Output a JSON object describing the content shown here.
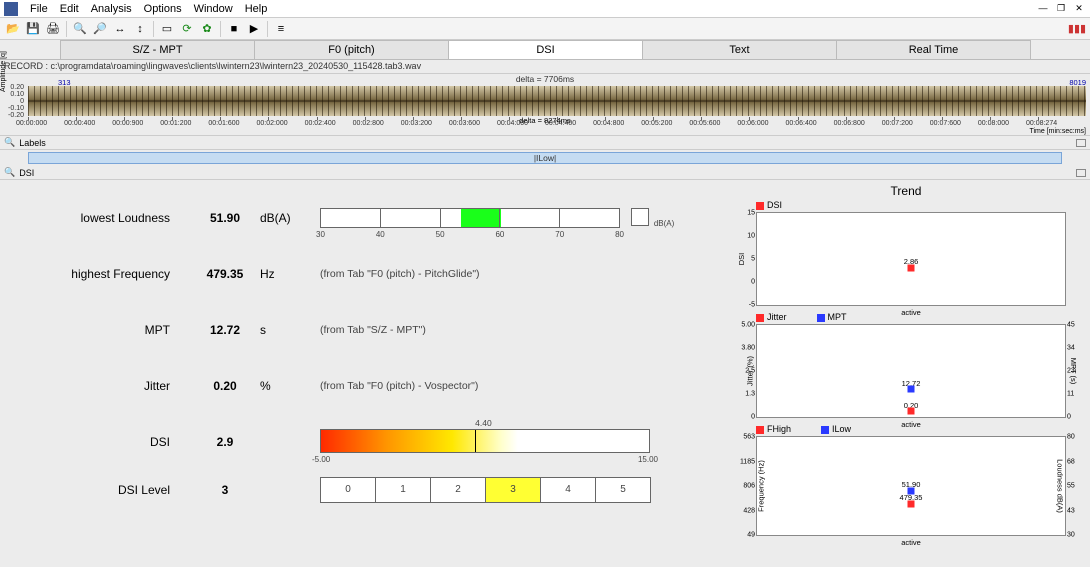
{
  "menu": {
    "items": [
      "File",
      "Edit",
      "Analysis",
      "Options",
      "Window",
      "Help"
    ]
  },
  "tabs": {
    "items": [
      "S/Z - MPT",
      "F0 (pitch)",
      "DSI",
      "Text",
      "Real Time"
    ],
    "active": 2
  },
  "record_path": "RECORD : c:\\programdata\\roaming\\lingwaves\\clients\\lwintern23\\lwintern23_20240530_115428.tab3.wav",
  "delta_top": "delta = 7706ms",
  "delta_mid": "delta = 8274ms",
  "waveform": {
    "marker_left": "313",
    "marker_right": "8019",
    "y_ticks": [
      "0.20",
      "0.10",
      "0",
      "-0.10",
      "-0.20"
    ],
    "y_label": "Amplitude [q]",
    "time_ticks": [
      "00:00:000",
      "00:00:400",
      "00:00:900",
      "00:01:200",
      "00:01:600",
      "00:02:000",
      "00:02:400",
      "00:02:800",
      "00:03:200",
      "00:03:600",
      "00:04:000",
      "00:04:400",
      "00:04:800",
      "00:05:200",
      "00:05:600",
      "00:06:000",
      "00:06:400",
      "00:06:800",
      "00:07:200",
      "00:07:600",
      "00:08:000",
      "00:08:274"
    ],
    "time_unit": "Time [min:sec:ms]"
  },
  "sections": {
    "labels": "Labels",
    "dsi": "DSI"
  },
  "label_segment": "|ILow|",
  "params": {
    "lowest_loudness": {
      "label": "lowest Loudness",
      "value": "51.90",
      "unit": "dB(A)"
    },
    "highest_freq": {
      "label": "highest Frequency",
      "value": "479.35",
      "unit": "Hz",
      "note": "(from Tab \"F0 (pitch) - PitchGlide\")"
    },
    "mpt": {
      "label": "MPT",
      "value": "12.72",
      "unit": "s",
      "note": "(from Tab \"S/Z - MPT\")"
    },
    "jitter": {
      "label": "Jitter",
      "value": "0.20",
      "unit": "%",
      "note": "(from Tab \"F0 (pitch) - Vospector\")"
    },
    "dsi": {
      "label": "DSI",
      "value": "2.9"
    },
    "dsi_level": {
      "label": "DSI Level",
      "value": "3"
    }
  },
  "loudness_bar": {
    "ticks": [
      "30",
      "40",
      "50",
      "60",
      "70",
      "80"
    ],
    "unit": "dB(A)"
  },
  "dsi_bar": {
    "marker_label": "4.40",
    "marker_pos_pct": 47,
    "min": "-5.00",
    "max": "15.00"
  },
  "dsi_levels": [
    "0",
    "1",
    "2",
    "3",
    "4",
    "5"
  ],
  "trend_title": "Trend",
  "chart_data": [
    {
      "type": "scatter",
      "legend": [
        {
          "name": "DSI",
          "color": "#ff2a2a"
        }
      ],
      "y_ticks_left": [
        "15",
        "10",
        "5",
        "0",
        "-5"
      ],
      "y_label_left": "DSI",
      "x_label": "active",
      "points": [
        {
          "series": "DSI",
          "label": "2.86",
          "x_pct": 50,
          "y_pct": 60,
          "color": "#ff2a2a"
        }
      ]
    },
    {
      "type": "scatter",
      "legend": [
        {
          "name": "Jitter",
          "color": "#ff2a2a"
        },
        {
          "name": "MPT",
          "color": "#2a3aff"
        }
      ],
      "y_ticks_left": [
        "5.00",
        "3.80",
        "2.5",
        "1.3",
        "0"
      ],
      "y_ticks_right": [
        "45",
        "34",
        "23",
        "11",
        "0"
      ],
      "y_label_left": "Jitter (%)",
      "y_label_right": "MPT (s)",
      "x_label": "active",
      "points": [
        {
          "series": "MPT",
          "label": "12.72",
          "x_pct": 50,
          "y_pct": 70,
          "color": "#2a3aff"
        },
        {
          "series": "Jitter",
          "label": "0.20",
          "x_pct": 50,
          "y_pct": 94,
          "color": "#ff2a2a"
        }
      ]
    },
    {
      "type": "scatter",
      "legend": [
        {
          "name": "FHigh",
          "color": "#ff2a2a"
        },
        {
          "name": "ILow",
          "color": "#2a3aff"
        }
      ],
      "y_ticks_left": [
        "563",
        "1185",
        "806",
        "428",
        "49"
      ],
      "y_ticks_right": [
        "80",
        "68",
        "55",
        "43",
        "30"
      ],
      "y_label_left": "Frequency (Hz)",
      "y_label_right": "Loudness dB(A)",
      "x_label": "active",
      "points": [
        {
          "series": "ILow",
          "label": "51.90",
          "x_pct": 50,
          "y_pct": 55,
          "color": "#2a3aff"
        },
        {
          "series": "FHigh",
          "label": "479.35",
          "x_pct": 50,
          "y_pct": 68,
          "color": "#ff2a2a"
        }
      ]
    }
  ]
}
